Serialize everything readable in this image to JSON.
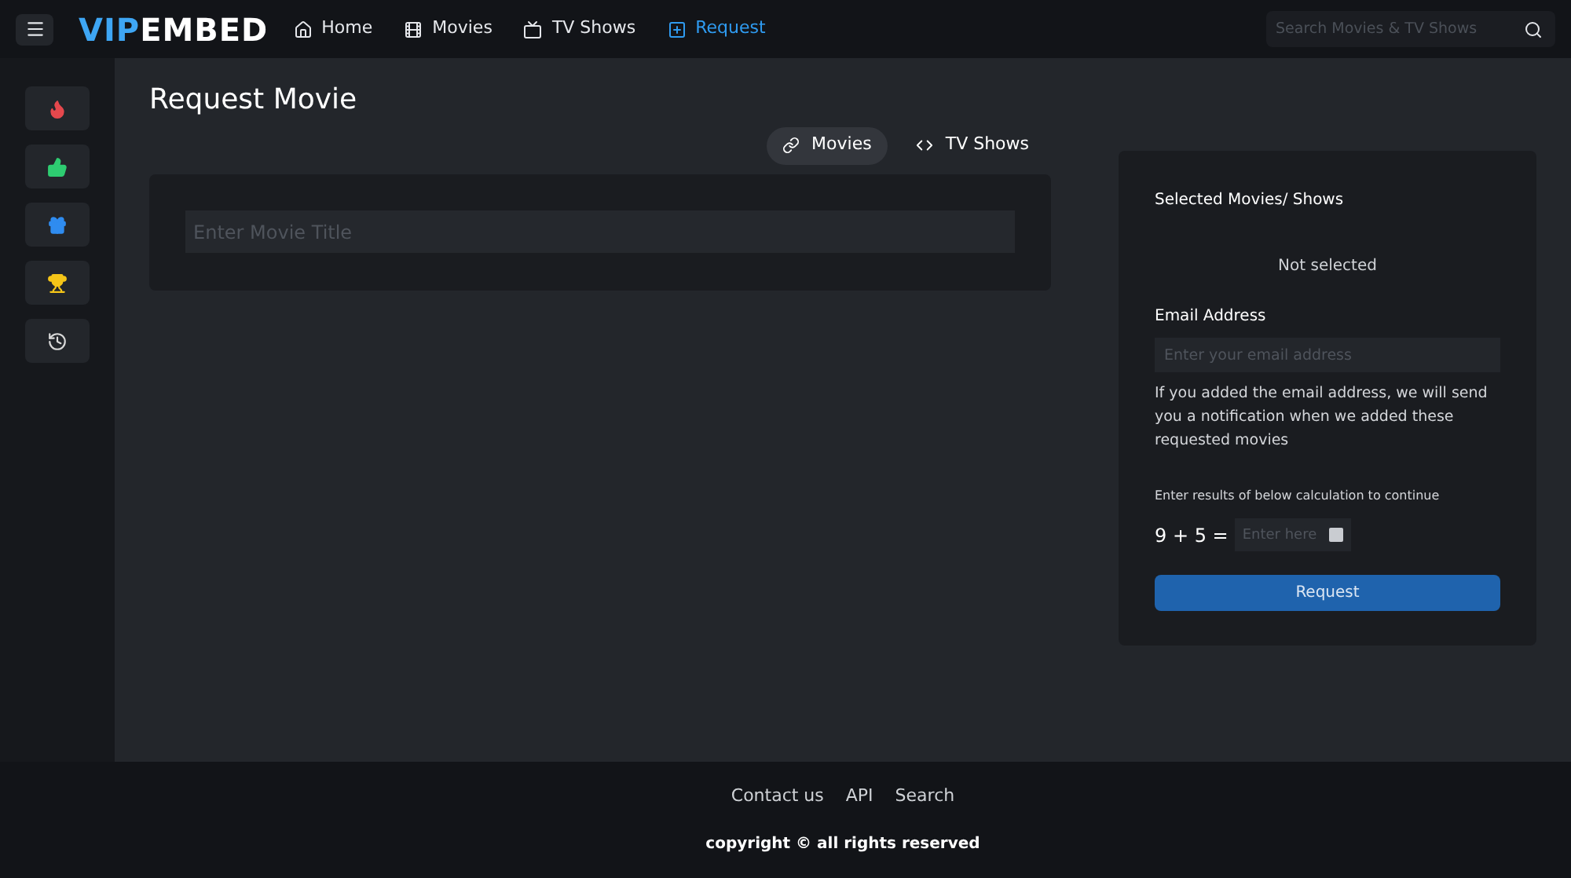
{
  "header": {
    "logo": {
      "accent": "VIP",
      "rest": "EMBED"
    },
    "nav": [
      {
        "label": "Home",
        "selected": false
      },
      {
        "label": "Movies",
        "selected": false
      },
      {
        "label": "TV Shows",
        "selected": false
      },
      {
        "label": "Request",
        "selected": true
      }
    ],
    "search": {
      "placeholder": "Search Movies & TV Shows"
    }
  },
  "sidebar": {
    "items": [
      {
        "color": "#e5484d"
      },
      {
        "color": "#2ecc71"
      },
      {
        "color": "#2f8cf0"
      },
      {
        "color": "#f5c518"
      },
      {
        "color": "#d9d9d9"
      }
    ]
  },
  "main": {
    "title": "Request Movie",
    "tabs": [
      {
        "label": "Movies",
        "selected": true
      },
      {
        "label": "TV Shows",
        "selected": false
      }
    ],
    "title_field": {
      "placeholder": "Enter Movie Title"
    }
  },
  "panel": {
    "heading": "Selected Movies/ Shows",
    "selection": "Not selected",
    "email_label": "Email Address",
    "email_placeholder": "Enter your email address",
    "note": "If you added the email address, we will send you a notification when we added these requested movies",
    "captcha_label": "Enter results of below calculation to continue",
    "captcha_question": "9 + 5 =",
    "captcha_placeholder": "Enter here",
    "button": "Request"
  },
  "footer": {
    "links": [
      "Contact us",
      "API",
      "Search"
    ],
    "copyright": "copyright © all rights reserved"
  }
}
